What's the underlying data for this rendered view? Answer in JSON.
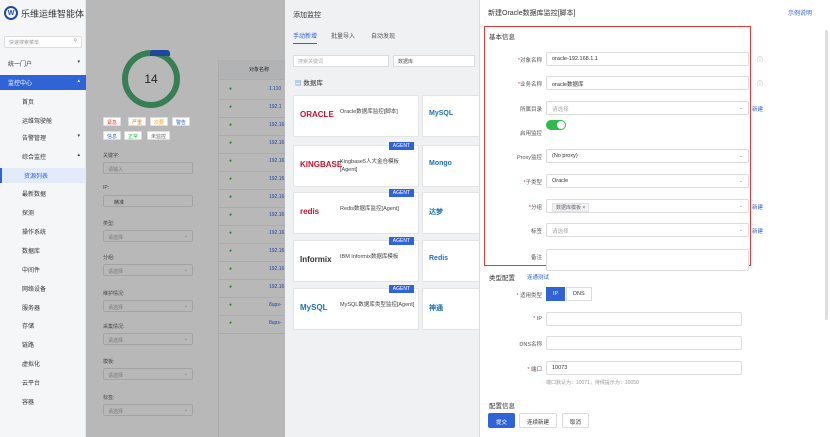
{
  "app": {
    "title": "乐维运维智能体",
    "search_placeholder": "快速搜索菜单"
  },
  "sidebar": {
    "items": [
      {
        "label": "统一门户",
        "chev": "▾"
      },
      {
        "label": "监控中心",
        "chev": "▴"
      },
      {
        "label": "首页"
      },
      {
        "label": "运维驾驶舱"
      },
      {
        "label": "告警管理",
        "chev": "▾"
      },
      {
        "label": "综合监控",
        "chev": "▴"
      },
      {
        "label": "资源列表"
      },
      {
        "label": "最新数据"
      },
      {
        "label": "探测"
      },
      {
        "label": "操作系统"
      },
      {
        "label": "数据库"
      },
      {
        "label": "中间件"
      },
      {
        "label": "网络设备"
      },
      {
        "label": "服务器"
      },
      {
        "label": "存储"
      },
      {
        "label": "链路"
      },
      {
        "label": "虚拟化"
      },
      {
        "label": "云平台"
      },
      {
        "label": "容器"
      }
    ]
  },
  "overview": {
    "count": "14",
    "tags": [
      "紧急",
      "严重",
      "次要",
      "警告",
      "信息",
      "正常",
      "未监控"
    ],
    "filters": [
      {
        "label": "关键字:",
        "ph": "请输入"
      },
      {
        "label": "IP:",
        "ph": ""
      },
      {
        "label": "类型:",
        "ph": "请选择"
      },
      {
        "label": "分组:",
        "ph": "请选择"
      },
      {
        "label": "维护情况:",
        "ph": "请选择"
      },
      {
        "label": "采集情况:",
        "ph": "请选择"
      },
      {
        "label": "模板:",
        "ph": "请选择"
      },
      {
        "label": "标签:",
        "ph": "请选择"
      }
    ],
    "ip_check": "精准",
    "table_header": "对象名称",
    "rows": [
      "1.110",
      "192.1",
      "192.16",
      "192.16",
      "192.16",
      "192.16",
      "192.16",
      "192.16",
      "192.16",
      "192.16",
      "192.16",
      "192.16",
      "8ups-",
      "8ups-"
    ]
  },
  "add_panel": {
    "title": "添加监控",
    "tabs": [
      "手动新增",
      "批量导入",
      "自动发现"
    ],
    "search_ph": "搜索关键词",
    "select_ph": "数据库",
    "section": "数据库",
    "cards": [
      {
        "brand": "ORACLE",
        "name": "Oracle数据库监控[脚本]",
        "agent": ""
      },
      {
        "brand": "KINGBASE",
        "name": "Kingbase5人大金仓模板[Agent]",
        "agent": "AGENT"
      },
      {
        "brand": "redis",
        "name": "Redis数据库监控[Agent]",
        "agent": "AGENT"
      },
      {
        "brand": "Informix",
        "name": "IBM Informix数据库模板",
        "agent": "AGENT"
      },
      {
        "brand": "MySQL",
        "name": "MySQL数据库类型监控[Agent]",
        "agent": "AGENT"
      }
    ],
    "right_cards": [
      "MySQL",
      "Mongo",
      "达梦",
      "Redis",
      "神通"
    ]
  },
  "drawer": {
    "title": "新建Oracle数据库监控[脚本]",
    "help": "示例说明",
    "basic": "基本信息",
    "fields": [
      {
        "label": "对象名称",
        "req": "*",
        "value": "oracle-192.168.1.1",
        "ph": false,
        "info": "ⓘ"
      },
      {
        "label": "业务名称",
        "req": "*",
        "value": "oracle数据库",
        "ph": false,
        "info": "ⓘ"
      },
      {
        "label": "所属目录",
        "req": "",
        "value": "请选择",
        "ph": true,
        "new": "新建"
      },
      {
        "label": "启用监控",
        "req": ""
      },
      {
        "label": "Proxy监控",
        "req": "",
        "value": "(No proxy)",
        "ph": false
      },
      {
        "label": "子类型",
        "req": "*",
        "value": "Oracle",
        "ph": false
      },
      {
        "label": "分组",
        "req": "*",
        "value": "数据库模板 ×",
        "ph": false,
        "new": "新建"
      },
      {
        "label": "标签",
        "req": "",
        "value": "请选择",
        "ph": true,
        "new": "新建"
      },
      {
        "label": "备注",
        "req": "",
        "value": "",
        "ph": false
      }
    ],
    "conn": "类型配置",
    "conn_test": "连通测试",
    "type_label": "适用类型",
    "type_ip": "IP",
    "type_dns": "DNS",
    "ip_label": "IP",
    "dns_label": "DNS名称",
    "port_label": "端口",
    "port_value": "10073",
    "port_hint": "端口默认为：10071，待候提示为：10050",
    "config": "配置信息",
    "buttons": {
      "submit": "提交",
      "continue": "连续新建",
      "cancel": "取消"
    }
  },
  "colors": {
    "primary": "#2f63d6",
    "success": "#2fbb4f",
    "danger": "#e53935"
  }
}
